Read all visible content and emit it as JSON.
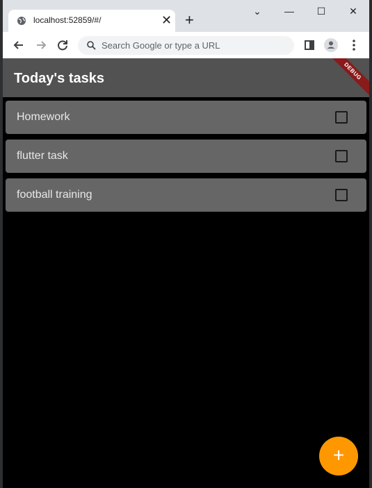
{
  "browser": {
    "tab_title": "localhost:52859/#/",
    "tab_close": "✕",
    "new_tab": "+",
    "window_controls": {
      "minimize": "—",
      "maximize": "☐",
      "close": "✕",
      "dropdown": "⌄"
    },
    "omnibox_placeholder": "Search Google or type a URL",
    "icons": {
      "back": "arrow-left-icon",
      "forward": "arrow-right-icon",
      "reload": "reload-icon",
      "sidepanel": "side-panel-icon",
      "profile": "profile-icon",
      "menu": "kebab-menu-icon"
    }
  },
  "app": {
    "title": "Today's tasks",
    "debug_banner": "DEBUG",
    "tasks": [
      {
        "label": "Homework",
        "checked": false
      },
      {
        "label": "flutter task",
        "checked": false
      },
      {
        "label": "football training",
        "checked": false
      }
    ],
    "fab_label": "+",
    "colors": {
      "appbar": "#525252",
      "task_card": "#666666",
      "background": "#000000",
      "fab": "#ff9800"
    }
  }
}
